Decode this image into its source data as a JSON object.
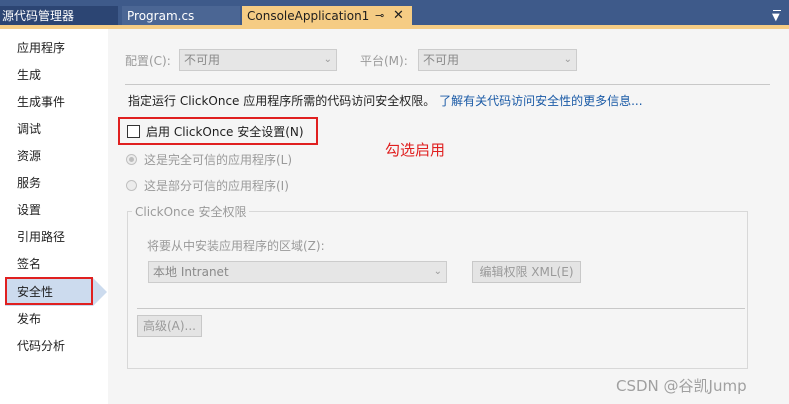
{
  "tabs": {
    "solution_explorer": "源代码管理器",
    "program": "Program.cs",
    "project": "ConsoleApplication1",
    "pin_glyph": "⊸",
    "close_glyph": "✕"
  },
  "colors": {
    "accent": "#f5cc84",
    "tabbar": "#3e5a8a",
    "highlight_red": "#e02020",
    "link": "#1a5aa6"
  },
  "sidebar": {
    "items": [
      "应用程序",
      "生成",
      "生成事件",
      "调试",
      "资源",
      "服务",
      "设置",
      "引用路径",
      "签名",
      "安全性",
      "发布",
      "代码分析"
    ],
    "selected": "安全性"
  },
  "config": {
    "configuration_label": "配置(C):",
    "configuration_value": "不可用",
    "platform_label": "平台(M):",
    "platform_value": "不可用"
  },
  "security": {
    "description": "指定运行 ClickOnce 应用程序所需的代码访问安全权限。",
    "learn_more_link": "了解有关代码访问安全性的更多信息...",
    "enable_label": "启用 ClickOnce 安全设置(N)",
    "annotation": "勾选启用",
    "full_trust": "这是完全可信的应用程序(L)",
    "partial_trust": "这是部分可信的应用程序(I)",
    "permissions_group": "ClickOnce 安全权限",
    "zone_label": "将要从中安装应用程序的区域(Z):",
    "zone_value": "本地 Intranet",
    "edit_xml_button": "编辑权限 XML(E)",
    "advanced_button": "高级(A)..."
  },
  "watermark": "CSDN @谷凯Jump"
}
